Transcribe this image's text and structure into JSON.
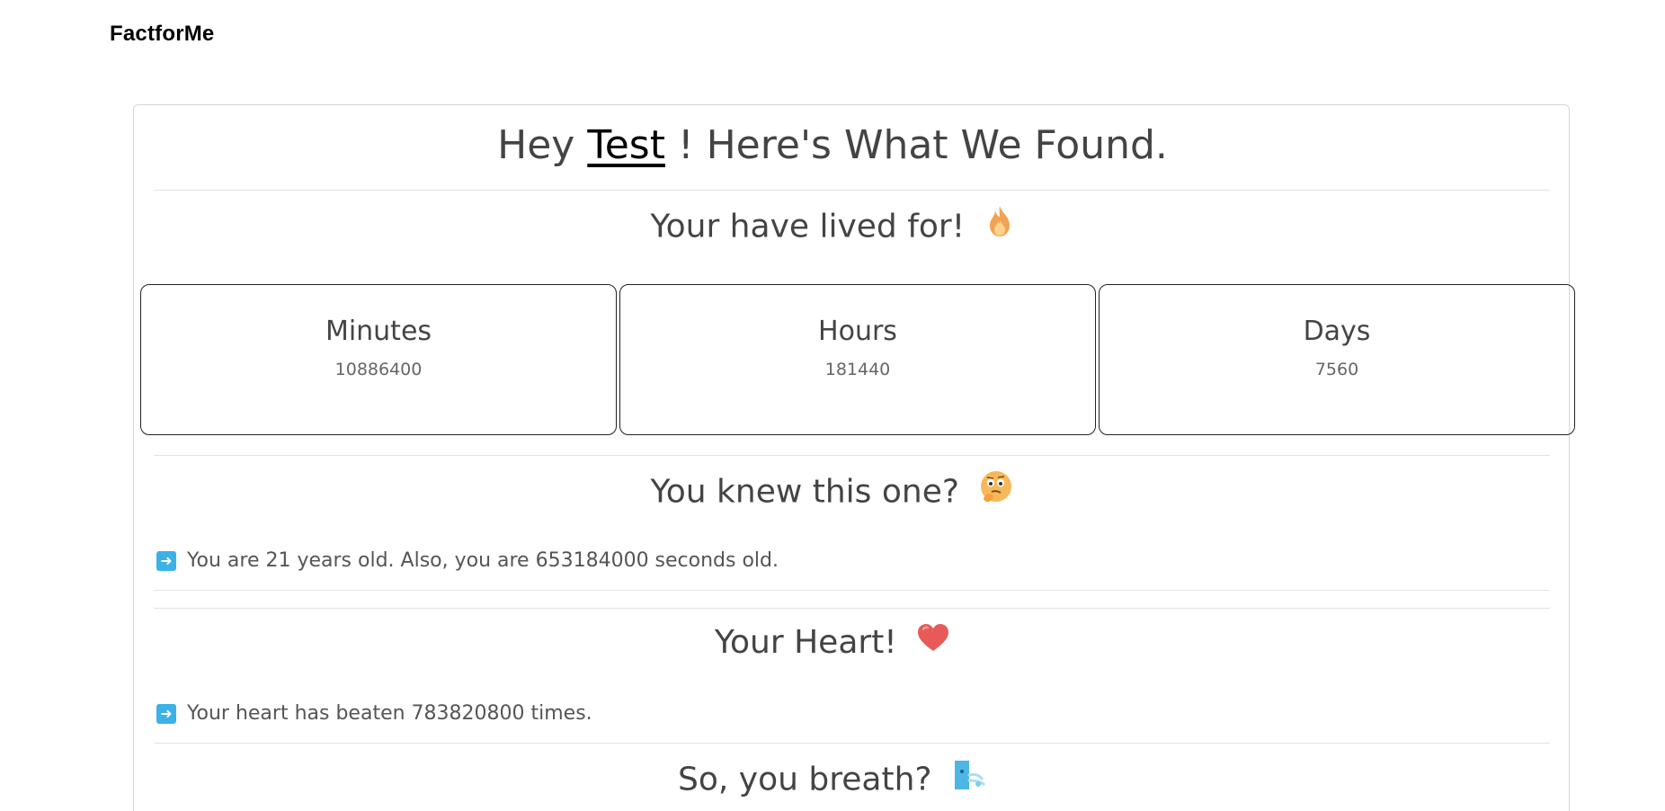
{
  "header": {
    "brand": "FactforMe"
  },
  "greeting": {
    "prefix": "Hey",
    "name": "Test",
    "suffix": "! Here's What We Found."
  },
  "lived": {
    "title": "Your have lived for!",
    "icon": "fire-icon",
    "stats": [
      {
        "label": "Minutes",
        "value": "10886400"
      },
      {
        "label": "Hours",
        "value": "181440"
      },
      {
        "label": "Days",
        "value": "7560"
      }
    ]
  },
  "knew": {
    "title": "You knew this one?",
    "icon": "thinking-face-icon",
    "fact": "You are 21 years old. Also, you are 653184000 seconds old."
  },
  "heart": {
    "title": "Your Heart!",
    "icon": "heart-icon",
    "fact": "Your heart has beaten 783820800 times."
  },
  "breath": {
    "title": "So, you breath?",
    "icon": "wind-face-icon"
  },
  "fact_icon": "arrow-right-icon",
  "colors": {
    "arrow_bg": "#3bb1e8",
    "heart": "#e85a5a",
    "fire": "#f3a253"
  }
}
